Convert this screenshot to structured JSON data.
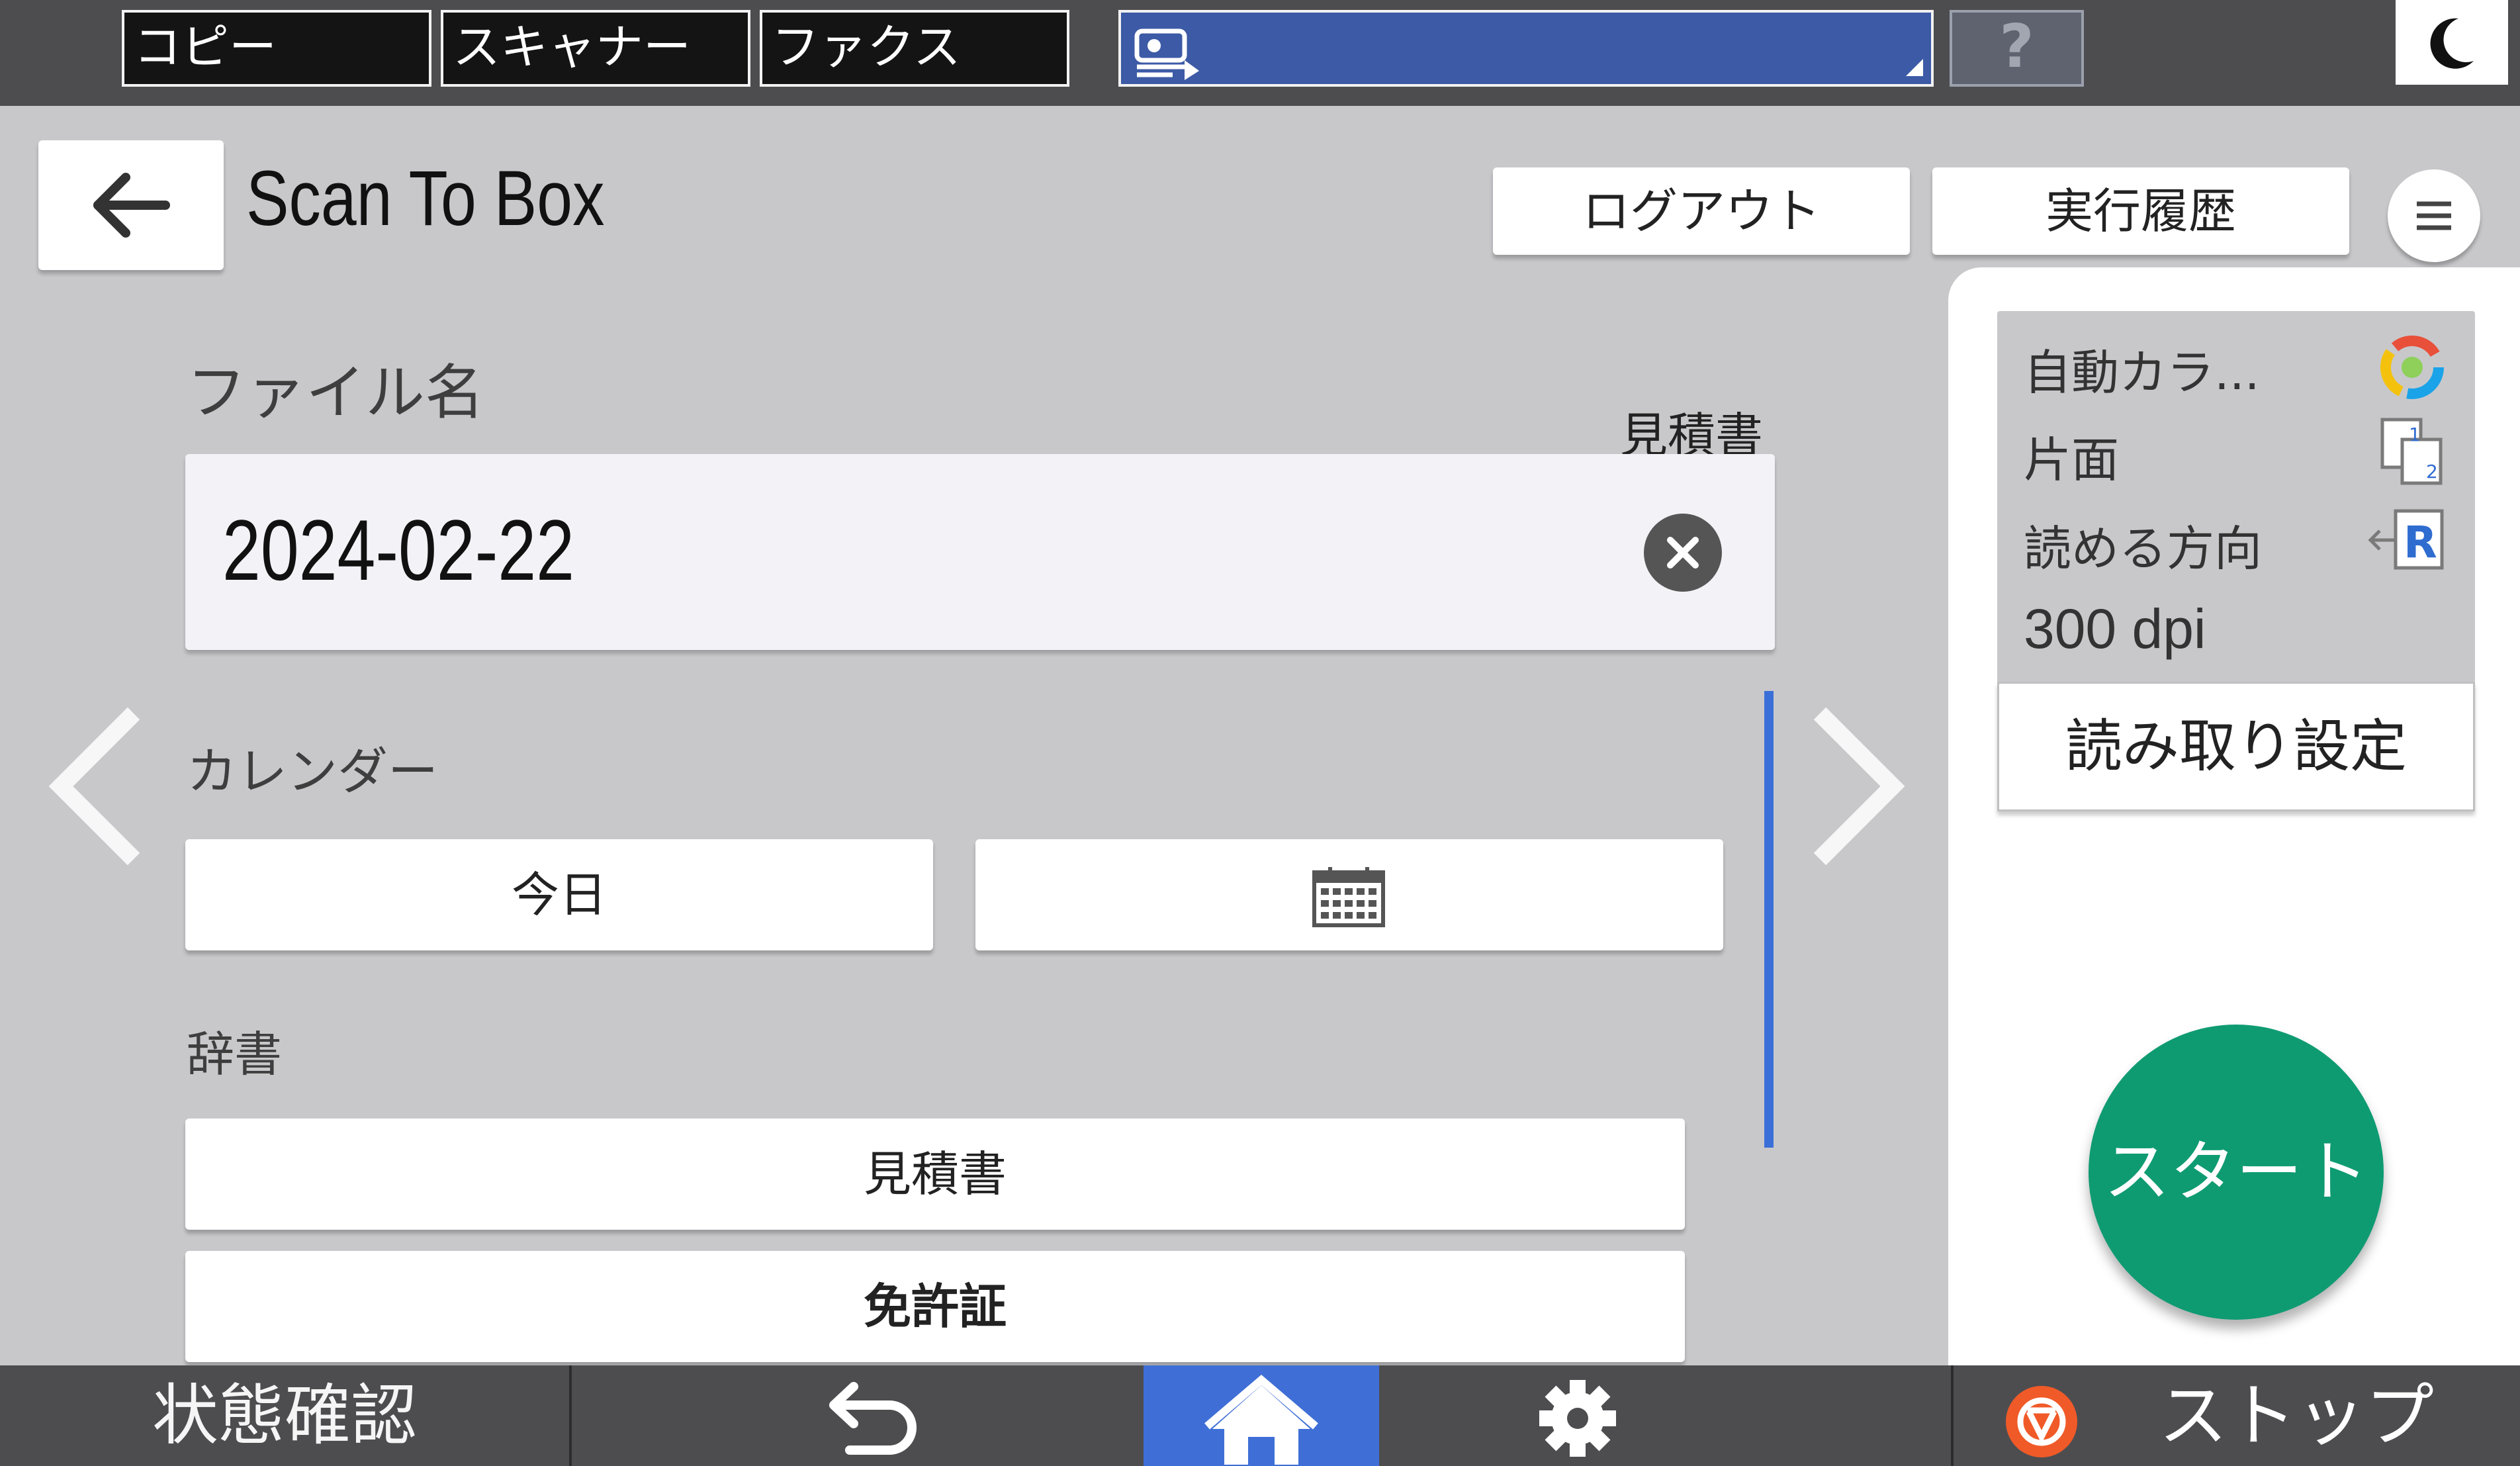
{
  "top_bar": {
    "tabs": [
      "コピー",
      "スキャナー",
      "ファクス"
    ],
    "help_label": "?",
    "icons": {
      "app_selector": "scan-to-app-icon",
      "sleep": "moon-icon"
    }
  },
  "header": {
    "title": "Scan To Box",
    "logout_label": "ログアウト",
    "history_label": "実行履歴",
    "menu_label": "☰"
  },
  "main": {
    "file_name_label": "ファイル名",
    "dictionary_preview": "見積書",
    "file_name_value": "2024-02-22",
    "calendar_label": "カレンダー",
    "today_label": "今日",
    "dictionary_label": "辞書",
    "dictionary_items": [
      "見積書",
      "免許証"
    ]
  },
  "settings_summary": {
    "color_mode": "自動カラ...",
    "sides": "片面",
    "orientation": "読める方向",
    "resolution": "300 dpi",
    "scan_settings_label": "読み取り設定",
    "start_label": "スタート"
  },
  "bottom_bar": {
    "status_label": "状態確認",
    "stop_label": "ストップ",
    "icons": {
      "back": "return-arrow-icon",
      "home": "home-icon",
      "settings": "gear-icon",
      "stop": "stop-icon"
    }
  },
  "colors": {
    "accent_blue": "#3c5aa5",
    "home_active": "#3f6fd6",
    "start_green": "#0f9b72",
    "scroll_indicator": "#3b6fd8",
    "stop_red": "#f05a28"
  }
}
